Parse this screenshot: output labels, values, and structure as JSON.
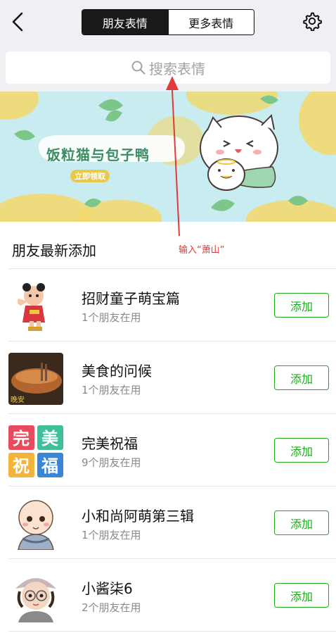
{
  "header": {
    "tabs": [
      {
        "label": "朋友表情",
        "active": true
      },
      {
        "label": "更多表情",
        "active": false
      }
    ],
    "back_icon": "chevron-left-icon",
    "settings_icon": "gear-icon"
  },
  "search": {
    "placeholder": "搜索表情",
    "icon": "search-icon"
  },
  "banner": {
    "title": "饭粒猫与包子鸭",
    "cta": "立即领取"
  },
  "section": {
    "title": "朋友最新添加"
  },
  "annotation": {
    "text": "输入“萧山”",
    "color": "#d93838"
  },
  "items": [
    {
      "title": "招财童子萌宝篇",
      "subtitle": "1个朋友在用",
      "button": "添加",
      "icon": "lucky-boy-sticker"
    },
    {
      "title": "美食的问候",
      "subtitle": "1个朋友在用",
      "button": "添加",
      "icon": "food-sticker"
    },
    {
      "title": "完美祝福",
      "subtitle": "9个朋友在用",
      "button": "添加",
      "icon": "blessing-sticker"
    },
    {
      "title": "小和尚阿萌第三辑",
      "subtitle": "1个朋友在用",
      "button": "添加",
      "icon": "little-monk-sticker"
    },
    {
      "title": "小酱柒6",
      "subtitle": "2个朋友在用",
      "button": "添加",
      "icon": "little-girl-sticker"
    }
  ],
  "colors": {
    "accent_green": "#1aad19",
    "segment_active_bg": "#1a1a1a",
    "header_bg": "#efeff4",
    "banner_bg": "#c9ecf0"
  },
  "thumb_text": {
    "blessing": [
      "完",
      "美",
      "祝",
      "福"
    ],
    "food_caption": "晚安"
  }
}
